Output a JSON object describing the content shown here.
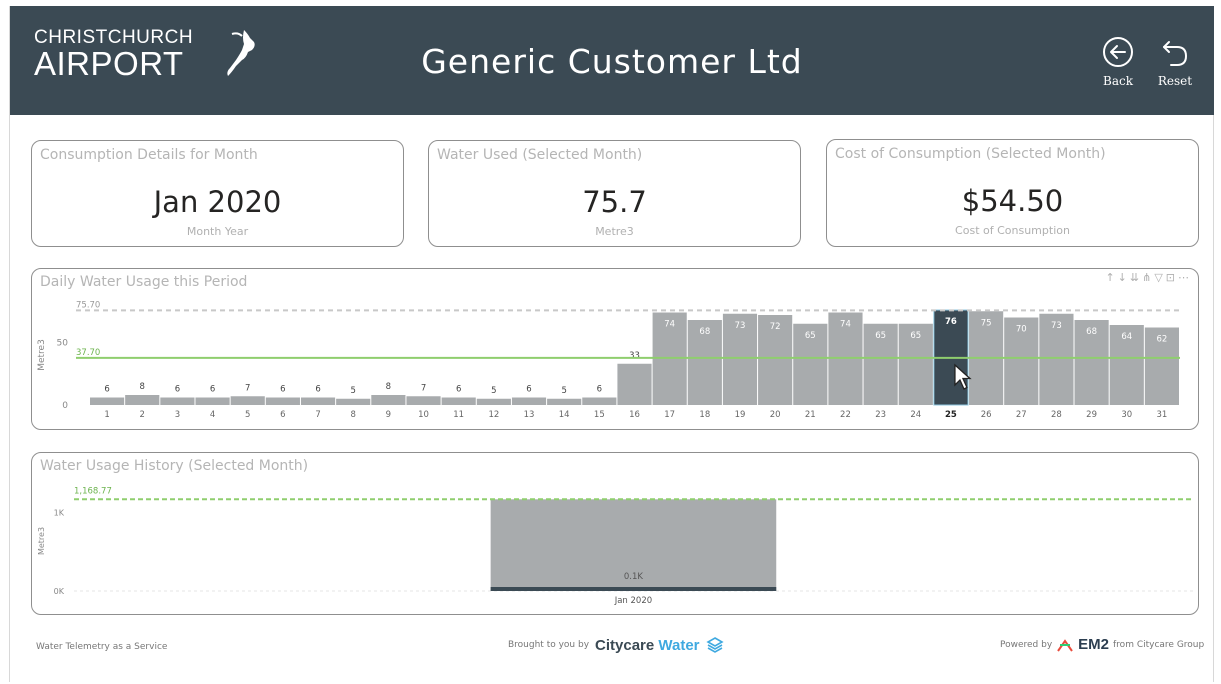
{
  "header": {
    "logo_line1": "CHRISTCHURCH",
    "logo_line2": "AIRPORT",
    "title": "Generic Customer Ltd",
    "back_label": "Back",
    "reset_label": "Reset",
    "bg_color": "#3b4a54"
  },
  "cards": [
    {
      "title": "Consumption Details for Month",
      "value": "Jan 2020",
      "sub": "Month Year"
    },
    {
      "title": "Water Used (Selected Month)",
      "value": "75.7",
      "sub": "Metre3"
    },
    {
      "title": "Cost of Consumption (Selected Month)",
      "value": "$54.50",
      "sub": "Cost of Consumption"
    }
  ],
  "daily_panel": {
    "title": "Daily Water Usage this Period",
    "icons": [
      "sort-asc-icon",
      "sort-desc-icon",
      "expand-icon",
      "hierarchy-icon",
      "filter-icon",
      "focus-icon",
      "more-icon"
    ]
  },
  "history_panel": {
    "title": "Water Usage History (Selected Month)"
  },
  "chart_data": [
    {
      "type": "bar",
      "ylabel": "Metre3",
      "ylim": [
        0,
        80
      ],
      "yticks": [
        "0",
        "50"
      ],
      "categories": [
        "1",
        "2",
        "3",
        "4",
        "5",
        "6",
        "7",
        "8",
        "9",
        "10",
        "11",
        "12",
        "13",
        "14",
        "15",
        "16",
        "17",
        "18",
        "19",
        "20",
        "21",
        "22",
        "23",
        "24",
        "25",
        "26",
        "27",
        "28",
        "29",
        "30",
        "31"
      ],
      "values": [
        6,
        8,
        6,
        6,
        7,
        6,
        6,
        5,
        8,
        7,
        6,
        5,
        6,
        5,
        6,
        33,
        74,
        68,
        73,
        72,
        65,
        74,
        65,
        65,
        76,
        75,
        70,
        73,
        68,
        64,
        62
      ],
      "selected_category": "25",
      "ref_lines": [
        {
          "label": "75.70",
          "value": 75.7,
          "color": "#c8c8c8",
          "style": "dashed"
        },
        {
          "label": "37.70",
          "value": 37.7,
          "color": "#8fce6e",
          "style": "solid"
        }
      ],
      "bar_color": "#a8abad",
      "selected_color": "#3b4a54"
    },
    {
      "type": "bar",
      "ylabel": "Metre3",
      "ylim": [
        0,
        1300
      ],
      "yticks": [
        "0K",
        "1K"
      ],
      "categories": [
        "Jan 2020"
      ],
      "values": [
        1168.77
      ],
      "data_labels": [
        "0.1K"
      ],
      "ref_lines": [
        {
          "label": "1,168.77",
          "value": 1168.77,
          "color": "#8fce6e",
          "style": "dashed"
        }
      ],
      "bar_color": "#a8abad"
    }
  ],
  "footer": {
    "left": "Water Telemetry as a Service",
    "mid_prefix": "Brought to you by",
    "mid_brand": "Citycare",
    "mid_brand2": "Water",
    "right_prefix": "Powered by",
    "right_brand": "EM2",
    "right_suffix": "from Citycare Group"
  }
}
